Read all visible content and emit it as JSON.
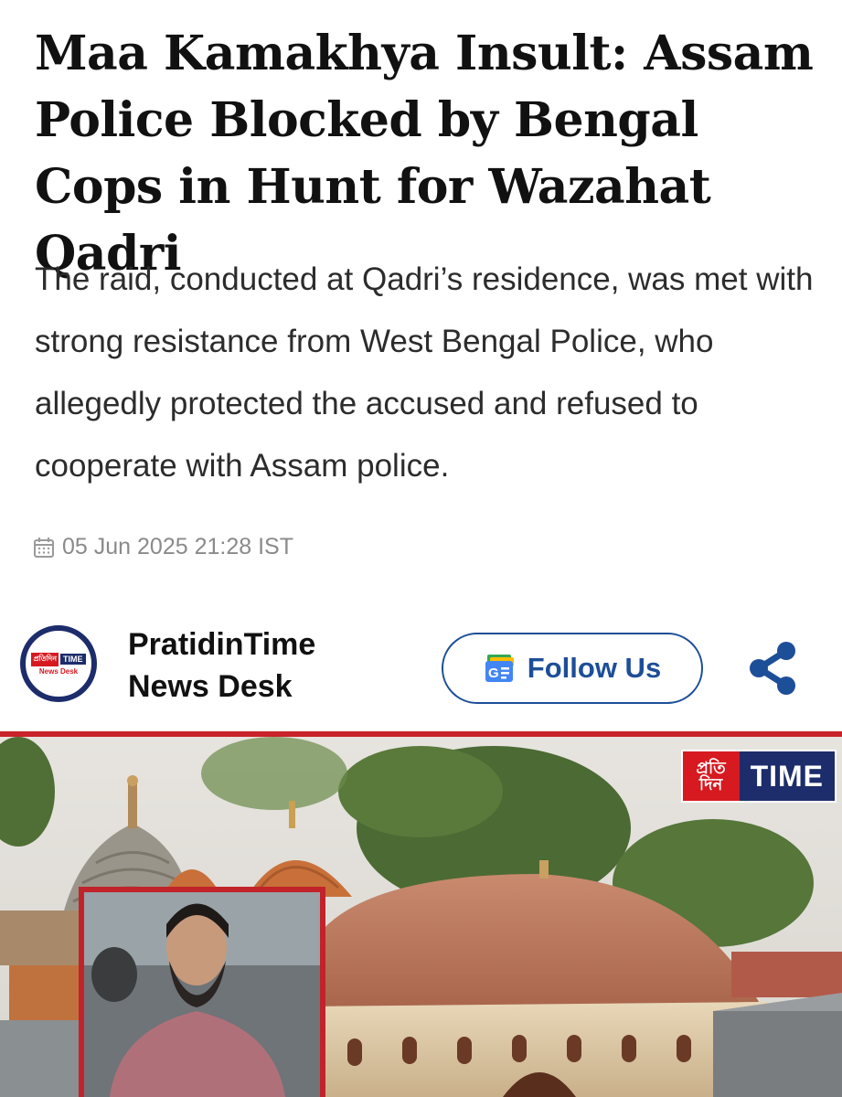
{
  "article": {
    "headline": "Maa Kamakhya Insult: Assam Police Blocked by Bengal Cops in Hunt for Wazahat Qadri",
    "summary": "The raid, conducted at Qadri’s residence, was met with strong resistance from West Bengal Police, who allegedly protected the accused and refused to cooperate with Assam police.",
    "date": "05 Jun 2025 21:28 IST"
  },
  "author": {
    "name_line1": "PratidinTime",
    "name_line2": "News Desk",
    "avatar_text_left": "প্রতিদিন",
    "avatar_text_right": "TIME",
    "avatar_sub": "News Desk"
  },
  "actions": {
    "follow_label": "Follow Us",
    "follow_icon": "google-news-icon",
    "share_icon": "share-icon"
  },
  "hero_image": {
    "logo_left": "প্রতি দিন",
    "logo_right": "TIME"
  },
  "colors": {
    "accent_blue": "#1d4e98",
    "brand_red": "#d71920",
    "brand_navy": "#1d2c6b",
    "meta_gray": "#8a8a8a"
  }
}
